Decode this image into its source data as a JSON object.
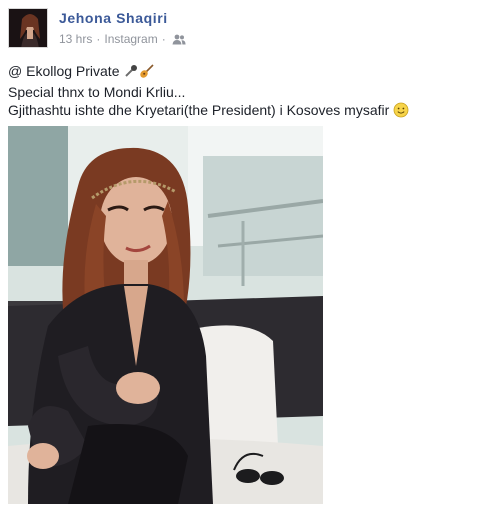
{
  "post": {
    "author": "Jehona Shaqiri",
    "time": "13 hrs",
    "separator": "·",
    "source": "Instagram",
    "audience_icon": "friends-icon",
    "text_line_1": "@ Ekollog Private",
    "text_line_2": "Special thnx to Mondi Krliu...",
    "text_line_3": "Gjithashtu ishte dhe Kryetari(the President) i Kosoves mysafir",
    "emoji_line_1": [
      "microphone-icon",
      "guitar-icon"
    ],
    "emoji_line_3": "smiley-icon"
  },
  "colors": {
    "link": "#3b5998",
    "meta": "#90949c",
    "text": "#1d2129"
  }
}
